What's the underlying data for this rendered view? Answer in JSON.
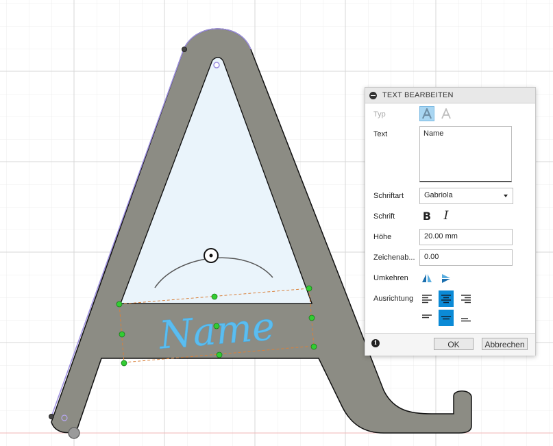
{
  "colors": {
    "accent": "#0b8ad6",
    "letter_fill": "#8c8c84",
    "name_text": "#5bbdf0",
    "grid": "#e6e6e6",
    "profile_fill": "#eaf4fb",
    "handle_green": "#33cc33",
    "bounding_dash": "#d9803a"
  },
  "canvas": {
    "sketch_text": "Name"
  },
  "dialog": {
    "title": "TEXT BEARBEITEN",
    "type_label": "Typ",
    "text_label": "Text",
    "text_value": "Name",
    "font_label": "Schriftart",
    "font_value": "Gabriola",
    "style_label": "Schrift",
    "bold_glyph": "B",
    "italic_glyph": "I",
    "height_label": "Höhe",
    "height_value": "20.00 mm",
    "spacing_label": "Zeichenab...",
    "spacing_value": "0.00",
    "flip_label": "Umkehren",
    "align_label": "Ausrichtung",
    "ok_label": "OK",
    "cancel_label": "Abbrechen",
    "icons": [
      "collapse-icon",
      "type-text-icon",
      "type-path-icon",
      "bold-icon",
      "italic-icon",
      "flip-horizontal-icon",
      "flip-vertical-icon",
      "align-left-icon",
      "align-center-icon",
      "align-right-icon",
      "valign-top-icon",
      "valign-middle-icon",
      "valign-bottom-icon",
      "info-icon"
    ]
  }
}
